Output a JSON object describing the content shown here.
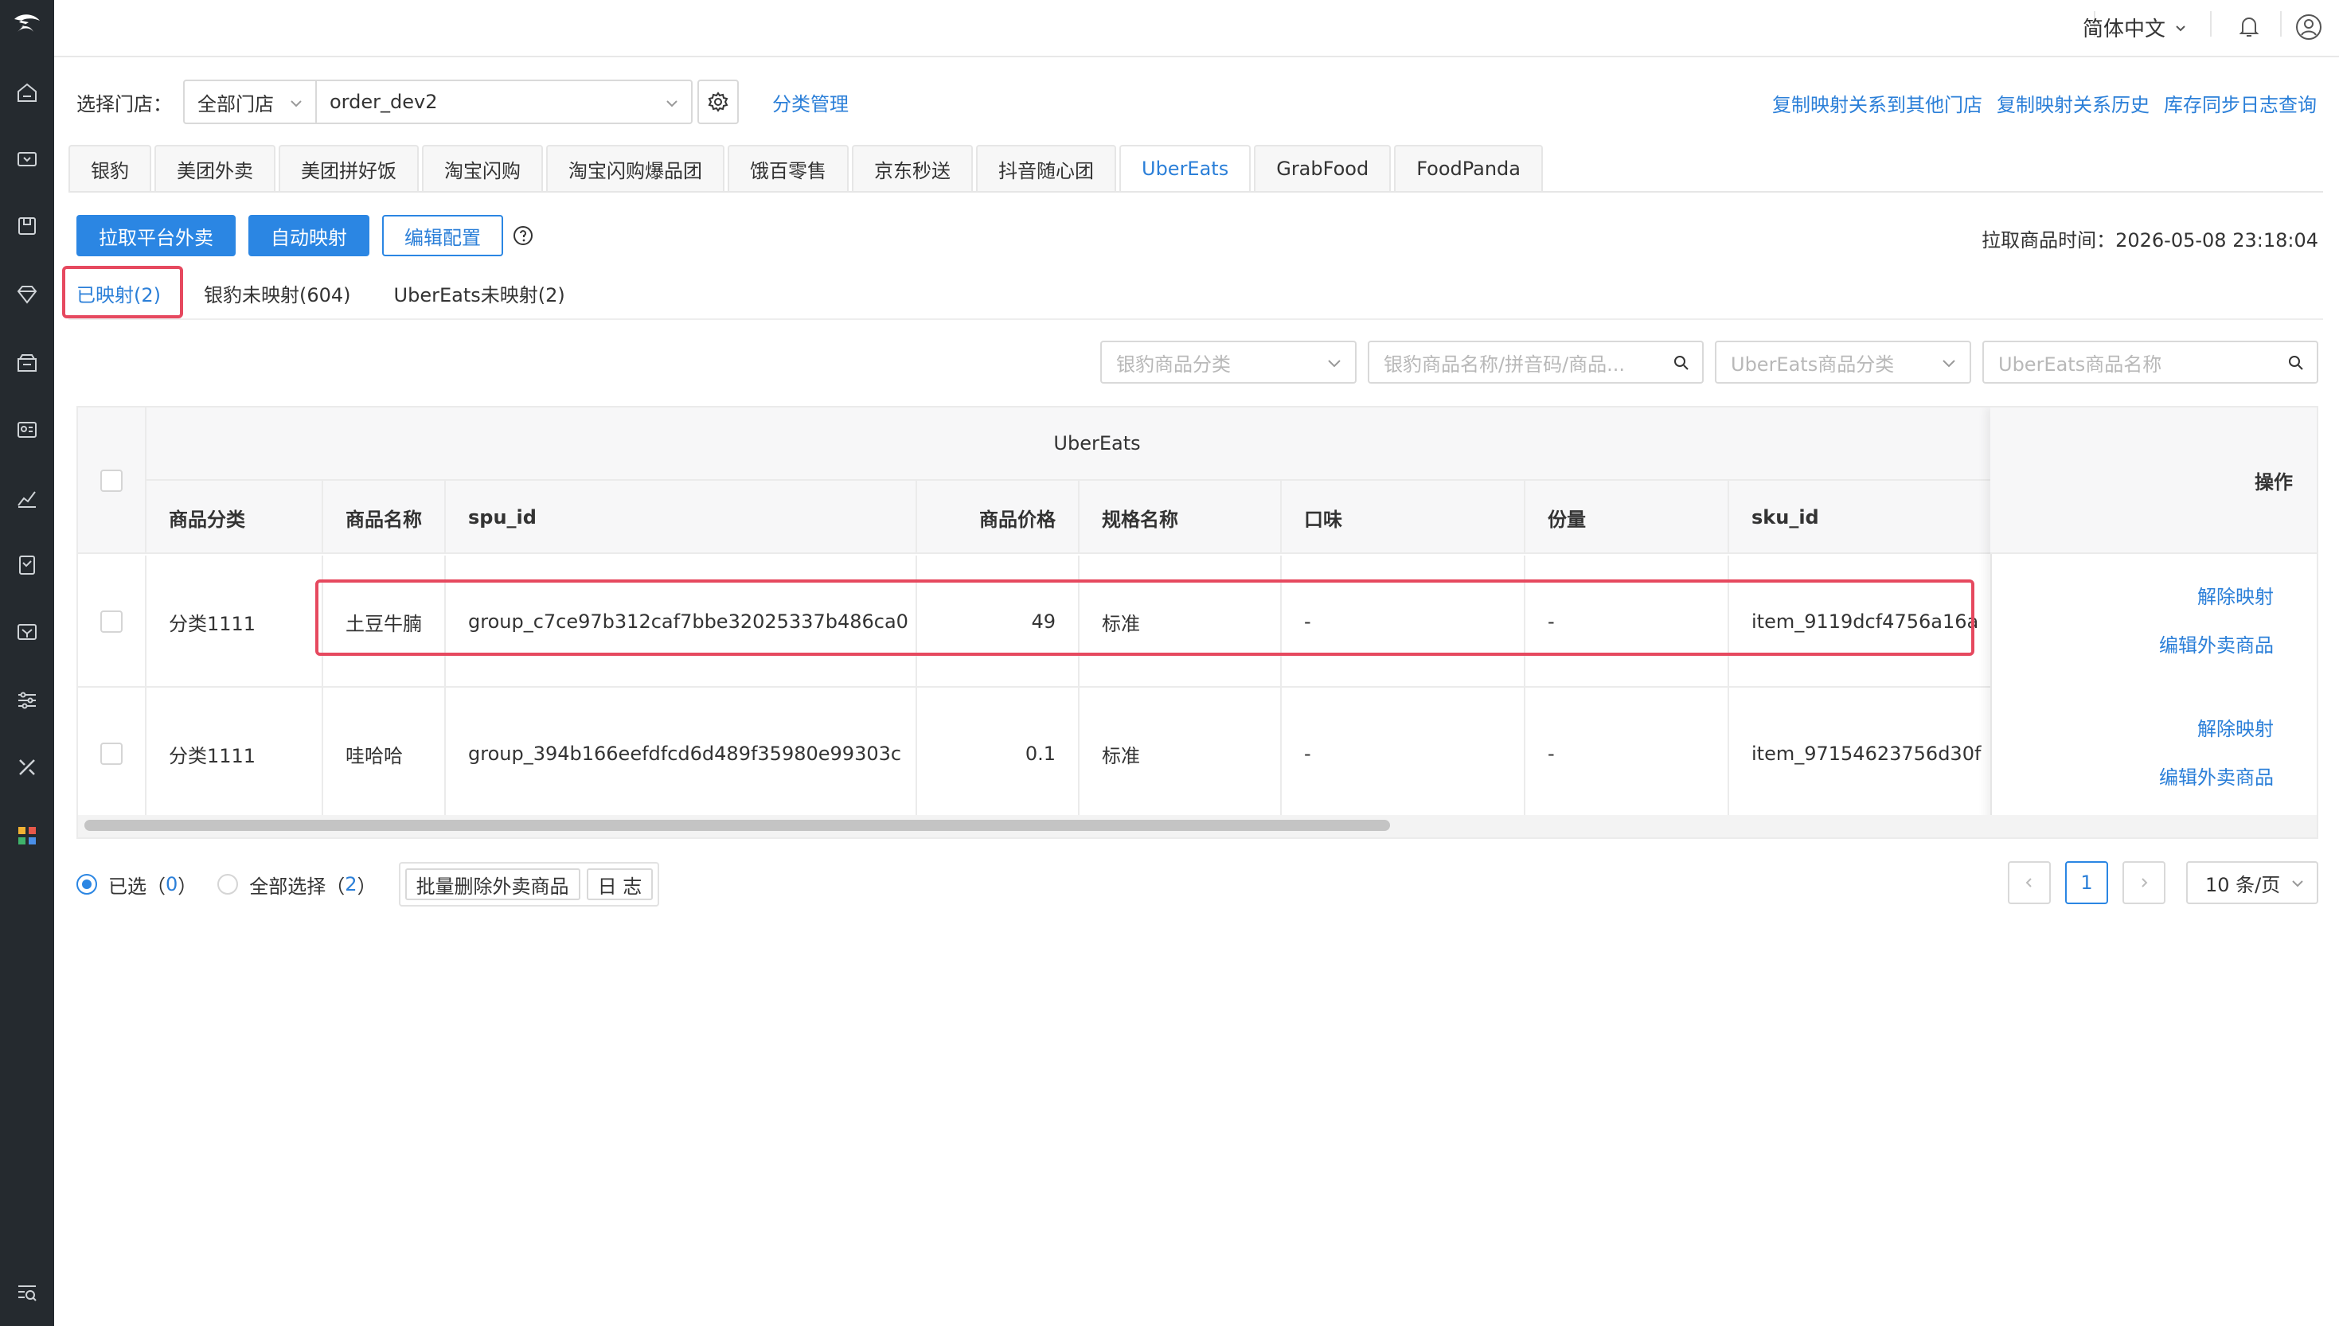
{
  "header": {
    "language": "简体中文"
  },
  "store": {
    "label": "选择门店：",
    "scope": "全部门店",
    "store_name": "order_dev2",
    "category_manage": "分类管理"
  },
  "top_links": [
    "复制映射关系到其他门店",
    "复制映射关系历史",
    "库存同步日志查询"
  ],
  "platform_tabs": [
    "银豹",
    "美团外卖",
    "美团拼好饭",
    "淘宝闪购",
    "淘宝闪购爆品团",
    "饿百零售",
    "京东秒送",
    "抖音随心团",
    "UberEats",
    "GrabFood",
    "FoodPanda"
  ],
  "active_platform": "UberEats",
  "actions": {
    "fetch": "拉取平台外卖",
    "auto_map": "自动映射",
    "edit_config": "编辑配置"
  },
  "fetch_time": "拉取商品时间：2026-05-08 23:18:04",
  "sub_tabs": [
    "已映射(2)",
    "银豹未映射(604)",
    "UberEats未映射(2)"
  ],
  "filters": {
    "yinbao_category": "银豹商品分类",
    "yinbao_search": "银豹商品名称/拼音码/商品...",
    "ubereats_category": "UberEats商品分类",
    "ubereats_name": "UberEats商品名称"
  },
  "table": {
    "group_title": "UberEats",
    "ops_header": "操作",
    "columns": [
      "商品分类",
      "商品名称",
      "spu_id",
      "商品价格",
      "规格名称",
      "口味",
      "份量",
      "sku_id"
    ],
    "rows": [
      {
        "category": "分类1111",
        "name": "土豆牛腩",
        "spu_id": "group_c7ce97b312caf7bbe32025337b486ca0",
        "price": "49",
        "spec": "标准",
        "flavor": "-",
        "portion": "-",
        "sku_id": "item_9119dcf4756a16a",
        "op1": "解除映射",
        "op2": "编辑外卖商品"
      },
      {
        "category": "分类1111",
        "name": "哇哈哈",
        "spu_id": "group_394b166eefdfcd6d489f35980e99303c",
        "price": "0.1",
        "spec": "标准",
        "flavor": "-",
        "portion": "-",
        "sku_id": "item_97154623756d30f",
        "op1": "解除映射",
        "op2": "编辑外卖商品"
      }
    ]
  },
  "footer": {
    "selected_label": "已选（",
    "selected_count": "0",
    "selected_close": "）",
    "select_all_label": "全部选择（",
    "select_all_count": "2",
    "select_all_close": "）",
    "batch_delete": "批量删除外卖商品",
    "log": "日 志"
  },
  "pagination": {
    "current": "1",
    "page_size": "10 条/页"
  },
  "colors": {
    "accent": "#2b86e3",
    "highlight": "#e6495f",
    "sidebar": "#252a2f"
  }
}
